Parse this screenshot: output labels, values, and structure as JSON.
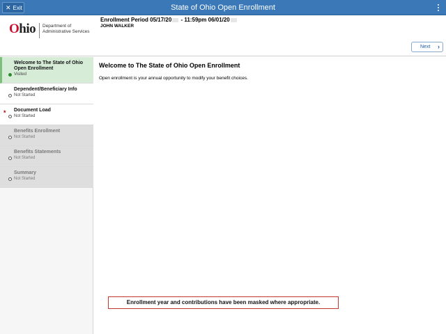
{
  "titlebar": {
    "exit_label": "Exit",
    "title": "State of Ohio Open Enrollment"
  },
  "header": {
    "logo_text": "Ohio",
    "dept_line1": "Department of",
    "dept_line2": "Administrative Services",
    "period_part1": "Enrollment Period 05/17/20",
    "period_part2": " - 11:59pm 06/01/20",
    "employee_name": "JOHN WALKER"
  },
  "sidebar": {
    "items": [
      {
        "title": "Welcome to The State of Ohio Open Enrollment",
        "status": "Visited"
      },
      {
        "title": "Dependent/Beneficiary Info",
        "status": "Not Started"
      },
      {
        "title": "Document Load",
        "status": "Not Started",
        "required_marker": "*"
      },
      {
        "title": "Benefits Enrollment",
        "status": "Not Started"
      },
      {
        "title": "Benefits Statements",
        "status": "Not Started"
      },
      {
        "title": "Summary",
        "status": "Not Started"
      }
    ]
  },
  "main": {
    "next_label": "Next",
    "title": "Welcome to The State of Ohio Open Enrollment",
    "body": "Open enrollment is your annual opportunity to modify your benefit choices."
  },
  "notice": "Enrollment year and contributions have been masked where appropriate.",
  "colors": {
    "titlebar": "#3a78b8",
    "active_step": "#d6ecd7",
    "disabled_step": "#dedede",
    "notice_border": "#c0392b"
  },
  "icons": [
    "close-icon",
    "more-vertical-icon",
    "chevron-right-icon",
    "visited-dot-icon",
    "status-dot-icon"
  ]
}
